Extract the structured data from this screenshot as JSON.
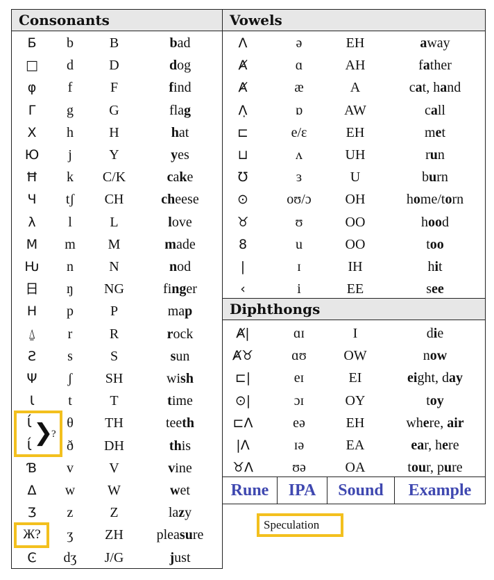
{
  "consonants": {
    "title": "Consonants",
    "rows": [
      {
        "rune": "Б",
        "ipa": "b",
        "sound": "B",
        "ex": [
          [
            "b",
            1
          ],
          [
            "ad",
            0
          ]
        ]
      },
      {
        "rune": "□",
        "ipa": "d",
        "sound": "D",
        "ex": [
          [
            "d",
            1
          ],
          [
            "og",
            0
          ]
        ]
      },
      {
        "rune": "φ",
        "ipa": "f",
        "sound": "F",
        "ex": [
          [
            "f",
            1
          ],
          [
            "ind",
            0
          ]
        ]
      },
      {
        "rune": "Γ",
        "ipa": "g",
        "sound": "G",
        "ex": [
          [
            "fla",
            0
          ],
          [
            "g",
            1
          ]
        ]
      },
      {
        "rune": "X",
        "ipa": "h",
        "sound": "H",
        "ex": [
          [
            "h",
            1
          ],
          [
            "at",
            0
          ]
        ]
      },
      {
        "rune": "Ю",
        "ipa": "j",
        "sound": "Y",
        "ex": [
          [
            "y",
            1
          ],
          [
            "es",
            0
          ]
        ]
      },
      {
        "rune": "Ħ",
        "ipa": "k",
        "sound": "C/K",
        "ex": [
          [
            "c",
            1
          ],
          [
            "a",
            0
          ],
          [
            "k",
            1
          ],
          [
            "e",
            0
          ]
        ]
      },
      {
        "rune": "Ч",
        "ipa": "tʃ",
        "sound": "CH",
        "ex": [
          [
            "ch",
            1
          ],
          [
            "eese",
            0
          ]
        ]
      },
      {
        "rune": "λ",
        "ipa": "l",
        "sound": "L",
        "ex": [
          [
            "l",
            1
          ],
          [
            "ove",
            0
          ]
        ]
      },
      {
        "rune": "M",
        "ipa": "m",
        "sound": "M",
        "ex": [
          [
            "m",
            1
          ],
          [
            "ade",
            0
          ]
        ]
      },
      {
        "rune": "Ԋ",
        "ipa": "n",
        "sound": "N",
        "ex": [
          [
            "n",
            1
          ],
          [
            "od",
            0
          ]
        ]
      },
      {
        "rune": "日",
        "ipa": "ŋ",
        "sound": "NG",
        "ex": [
          [
            "fi",
            0
          ],
          [
            "ng",
            1
          ],
          [
            "er",
            0
          ]
        ]
      },
      {
        "rune": "H",
        "ipa": "p",
        "sound": "P",
        "ex": [
          [
            "ma",
            0
          ],
          [
            "p",
            1
          ]
        ]
      },
      {
        "rune": "⍙",
        "ipa": "r",
        "sound": "R",
        "ex": [
          [
            "r",
            1
          ],
          [
            "ock",
            0
          ]
        ]
      },
      {
        "rune": "Ƨ",
        "ipa": "s",
        "sound": "S",
        "ex": [
          [
            "s",
            1
          ],
          [
            "un",
            0
          ]
        ]
      },
      {
        "rune": "Ψ",
        "ipa": "ʃ",
        "sound": "SH",
        "ex": [
          [
            "wi",
            0
          ],
          [
            "sh",
            1
          ]
        ]
      },
      {
        "rune": "Ɩ",
        "ipa": "t",
        "sound": "T",
        "ex": [
          [
            "t",
            1
          ],
          [
            "ime",
            0
          ]
        ]
      },
      {
        "rune": "Ɩ́",
        "ipa": "θ",
        "sound": "TH",
        "ex": [
          [
            "tee",
            0
          ],
          [
            "th",
            1
          ]
        ]
      },
      {
        "rune": "Ɩ́",
        "ipa": "ð",
        "sound": "DH",
        "ex": [
          [
            "th",
            1
          ],
          [
            "is",
            0
          ]
        ]
      },
      {
        "rune": "Ɓ",
        "ipa": "v",
        "sound": "V",
        "ex": [
          [
            "v",
            1
          ],
          [
            "ine",
            0
          ]
        ]
      },
      {
        "rune": "Δ",
        "ipa": "w",
        "sound": "W",
        "ex": [
          [
            "w",
            1
          ],
          [
            "et",
            0
          ]
        ]
      },
      {
        "rune": "Ʒ",
        "ipa": "z",
        "sound": "Z",
        "ex": [
          [
            "la",
            0
          ],
          [
            "z",
            1
          ],
          [
            "y",
            0
          ]
        ]
      },
      {
        "rune": "Ж?",
        "ipa": "ʒ",
        "sound": "ZH",
        "ex": [
          [
            "plea",
            0
          ],
          [
            "su",
            1
          ],
          [
            "re",
            0
          ]
        ]
      },
      {
        "rune": "Ͼ",
        "ipa": "dʒ",
        "sound": "J/G",
        "ex": [
          [
            "j",
            1
          ],
          [
            "ust",
            0
          ]
        ]
      }
    ],
    "bracket_glyph": "❯",
    "bracket_question": "?"
  },
  "vowels": {
    "title": "Vowels",
    "rows": [
      {
        "rune": "Λ",
        "ipa": "ə",
        "sound": "EH",
        "ex": [
          [
            "a",
            1
          ],
          [
            "way",
            0
          ]
        ]
      },
      {
        "rune": "Ⱥ",
        "ipa": "ɑ",
        "sound": "AH",
        "ex": [
          [
            "f",
            0
          ],
          [
            "a",
            1
          ],
          [
            "ther",
            0
          ]
        ]
      },
      {
        "rune": "Ⱥ",
        "ipa": "æ",
        "sound": "A",
        "ex": [
          [
            "c",
            0
          ],
          [
            "a",
            1
          ],
          [
            "t, h",
            0
          ],
          [
            "a",
            1
          ],
          [
            "nd",
            0
          ]
        ]
      },
      {
        "rune": "Λ̣",
        "ipa": "ɒ",
        "sound": "AW",
        "ex": [
          [
            "c",
            0
          ],
          [
            "a",
            1
          ],
          [
            "ll",
            0
          ]
        ]
      },
      {
        "rune": "⊏",
        "ipa": "e/ɛ",
        "sound": "EH",
        "ex": [
          [
            "m",
            0
          ],
          [
            "e",
            1
          ],
          [
            "t",
            0
          ]
        ]
      },
      {
        "rune": "⊔",
        "ipa": "ʌ",
        "sound": "UH",
        "ex": [
          [
            "r",
            0
          ],
          [
            "u",
            1
          ],
          [
            "n",
            0
          ]
        ]
      },
      {
        "rune": "Ʊ",
        "ipa": "ɜ",
        "sound": "U",
        "ex": [
          [
            "b",
            0
          ],
          [
            "u",
            1
          ],
          [
            "rn",
            0
          ]
        ]
      },
      {
        "rune": "⊙",
        "ipa": "oʊ/ɔ",
        "sound": "OH",
        "ex": [
          [
            "h",
            0
          ],
          [
            "o",
            1
          ],
          [
            "me/t",
            0
          ],
          [
            "o",
            1
          ],
          [
            "rn",
            0
          ]
        ]
      },
      {
        "rune": "♉",
        "ipa": "ʊ",
        "sound": "OO",
        "ex": [
          [
            "h",
            0
          ],
          [
            "oo",
            1
          ],
          [
            "d",
            0
          ]
        ]
      },
      {
        "rune": "8",
        "ipa": "u",
        "sound": "OO",
        "ex": [
          [
            "t",
            0
          ],
          [
            "oo",
            1
          ]
        ]
      },
      {
        "rune": "|",
        "ipa": "ɪ",
        "sound": "IH",
        "ex": [
          [
            "h",
            0
          ],
          [
            "i",
            1
          ],
          [
            "t",
            0
          ]
        ]
      },
      {
        "rune": "‹",
        "ipa": "i",
        "sound": "EE",
        "ex": [
          [
            "s",
            0
          ],
          [
            "ee",
            1
          ]
        ]
      }
    ]
  },
  "diphthongs": {
    "title": "Diphthongs",
    "rows": [
      {
        "rune": "Ⱥ|",
        "ipa": "ɑɪ",
        "sound": "I",
        "ex": [
          [
            "d",
            0
          ],
          [
            "i",
            1
          ],
          [
            "e",
            0
          ]
        ]
      },
      {
        "rune": "Ⱥ♉",
        "ipa": "ɑʊ",
        "sound": "OW",
        "ex": [
          [
            "n",
            0
          ],
          [
            "ow",
            1
          ]
        ]
      },
      {
        "rune": "⊏|",
        "ipa": "eɪ",
        "sound": "EI",
        "ex": [
          [
            "ei",
            1
          ],
          [
            "ght, d",
            0
          ],
          [
            "ay",
            1
          ]
        ]
      },
      {
        "rune": "⊙|",
        "ipa": "ɔɪ",
        "sound": "OY",
        "ex": [
          [
            "t",
            0
          ],
          [
            "oy",
            1
          ]
        ]
      },
      {
        "rune": "⊏Λ",
        "ipa": "eə",
        "sound": "EH",
        "ex": [
          [
            "wh",
            0
          ],
          [
            "e",
            1
          ],
          [
            "re, ",
            0
          ],
          [
            "air",
            1
          ]
        ]
      },
      {
        "rune": "|Λ",
        "ipa": "ɪə",
        "sound": "EA",
        "ex": [
          [
            "ea",
            1
          ],
          [
            "r, h",
            0
          ],
          [
            "e",
            1
          ],
          [
            "re",
            0
          ]
        ]
      },
      {
        "rune": "♉Λ",
        "ipa": "ʊə",
        "sound": "OA",
        "ex": [
          [
            "t",
            0
          ],
          [
            "ou",
            1
          ],
          [
            "r, p",
            0
          ],
          [
            "u",
            1
          ],
          [
            "re",
            0
          ]
        ]
      }
    ]
  },
  "legend": {
    "labels": [
      "Rune",
      "IPA",
      "Sound",
      "Example"
    ],
    "color": "#3f48b0"
  },
  "speculation_label": "Speculation",
  "highlight_color": "#f3c01e"
}
